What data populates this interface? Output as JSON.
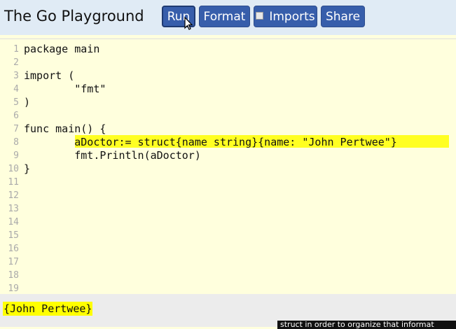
{
  "app": {
    "title": "The Go Playground"
  },
  "toolbar": {
    "run_label": "Run",
    "format_label": "Format",
    "imports_label": "Imports",
    "imports_checked": false,
    "share_label": "Share",
    "accent_color": "#375eab"
  },
  "editor": {
    "line_numbers": [
      "1",
      "2",
      "3",
      "4",
      "5",
      "6",
      "7",
      "8",
      "9",
      "10",
      "11",
      "12",
      "13",
      "14",
      "15",
      "16",
      "17",
      "18",
      "19"
    ],
    "lines": [
      "package main",
      "",
      "import (",
      "        \"fmt\"",
      ")",
      "",
      "func main() {",
      "        aDoctor:= struct{name string}{name: \"John Pertwee\"}",
      "        fmt.Println(aDoctor)",
      "}",
      "",
      "",
      "",
      "",
      "",
      "",
      "",
      "",
      ""
    ],
    "highlighted_line": 8,
    "background_color": "#ffffdd",
    "highlight_color": "#ffff22"
  },
  "output": {
    "text": "{John Pertwee}"
  },
  "caption": {
    "text": "struct in order to organize that informat"
  }
}
